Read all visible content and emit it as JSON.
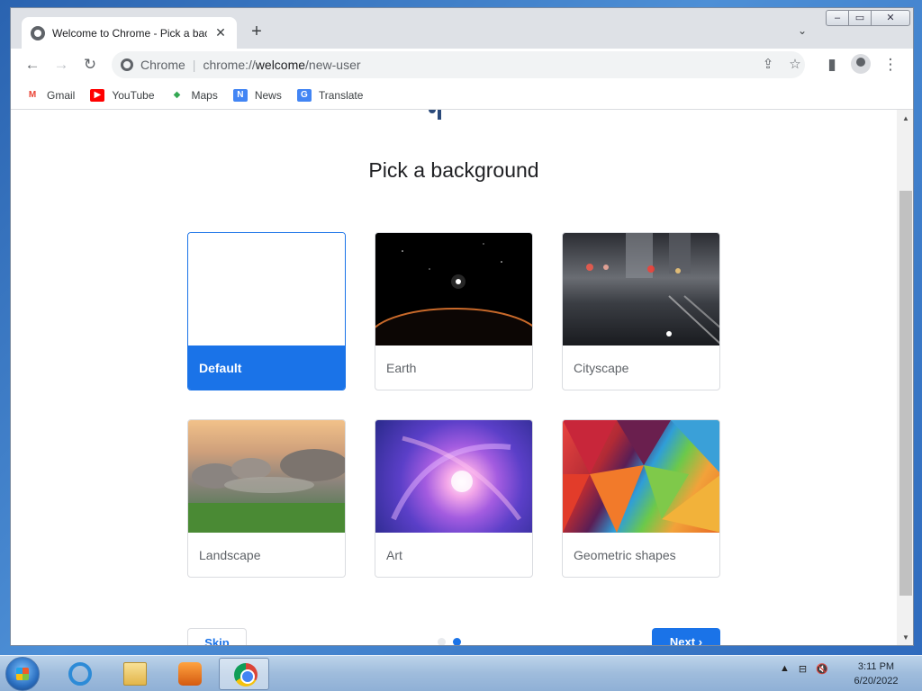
{
  "browser": {
    "tab_title": "Welcome to Chrome - Pick a bac",
    "tab_close_glyph": "✕",
    "newtab_glyph": "+",
    "tab_search_glyph": "⌄",
    "window_controls": {
      "minimize": "–",
      "maximize": "▭",
      "close": "✕"
    }
  },
  "toolbar": {
    "back": "←",
    "forward": "→",
    "reload": "↻",
    "omnibox": {
      "origin": "Chrome",
      "url_prefix": "chrome://",
      "url_host": "welcome",
      "url_path": "/new-user"
    },
    "share_icon": "⇪",
    "star_icon": "☆",
    "sidepanel_icon": "▮",
    "menu_icon": "⋮"
  },
  "bookmarks": [
    {
      "label": "Gmail",
      "icon": "M",
      "color": "#ea4335"
    },
    {
      "label": "YouTube",
      "icon": "▶",
      "color": "#ff0000"
    },
    {
      "label": "Maps",
      "icon": "◆",
      "color": "#34a853"
    },
    {
      "label": "News",
      "icon": "N",
      "color": "#4285f4"
    },
    {
      "label": "Translate",
      "icon": "G",
      "color": "#4285f4"
    }
  ],
  "page": {
    "title": "Pick a background",
    "cards": [
      {
        "label": "Default",
        "selected": true
      },
      {
        "label": "Earth"
      },
      {
        "label": "Cityscape"
      },
      {
        "label": "Landscape"
      },
      {
        "label": "Art"
      },
      {
        "label": "Geometric shapes"
      }
    ],
    "skip_label": "Skip",
    "next_label": "Next",
    "next_chevron": "›",
    "step": {
      "current": 2,
      "total": 2
    }
  },
  "scrollbar": {
    "up": "▲",
    "down": "▼"
  },
  "taskbar": {
    "time": "3:11 PM",
    "date": "6/20/2022",
    "tray_icons": [
      "▲",
      "⊟",
      "🔇"
    ]
  },
  "colors": {
    "accent": "#1a73e8",
    "text": "#202124",
    "muted": "#5f6368"
  }
}
